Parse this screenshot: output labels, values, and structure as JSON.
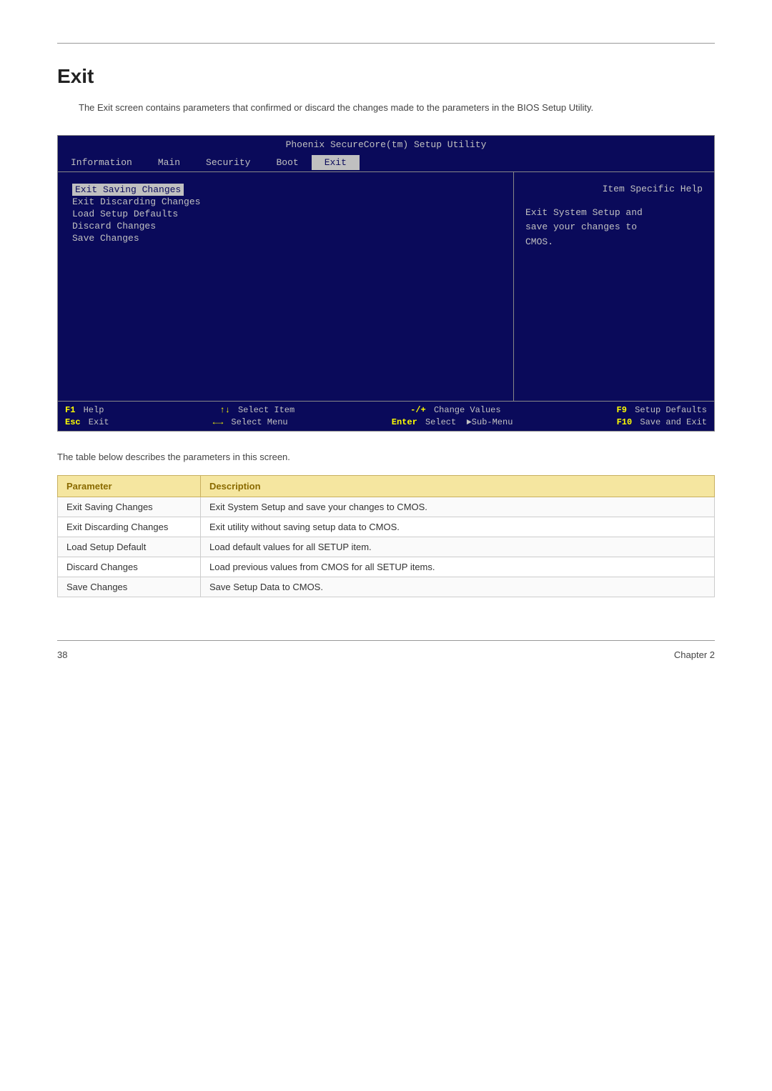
{
  "page": {
    "title": "Exit",
    "intro": "The Exit screen contains parameters that confirmed or discard the changes made to the parameters in the BIOS Setup Utility."
  },
  "bios": {
    "title": "Phoenix SecureCore(tm) Setup Utility",
    "nav": {
      "items": [
        {
          "label": "Information",
          "active": false
        },
        {
          "label": "Main",
          "active": false
        },
        {
          "label": "Security",
          "active": false
        },
        {
          "label": "Boot",
          "active": false
        },
        {
          "label": "Exit",
          "active": true
        }
      ]
    },
    "menu": {
      "items": [
        {
          "label": "Exit Saving Changes",
          "highlighted": true
        },
        {
          "label": "Exit Discarding Changes",
          "highlighted": false
        },
        {
          "label": "Load Setup Defaults",
          "highlighted": false
        },
        {
          "label": "Discard Changes",
          "highlighted": false
        },
        {
          "label": "Save Changes",
          "highlighted": false
        }
      ]
    },
    "help": {
      "title": "Item Specific Help",
      "text": "Exit System Setup and\nsave your changes to\nCMOS."
    },
    "footer": {
      "row1": [
        {
          "key": "F1",
          "desc": "Help"
        },
        {
          "key": "↑↓",
          "desc": "Select Item"
        },
        {
          "key": "-/+",
          "desc": "Change Values"
        },
        {
          "key": "F9",
          "desc": "Setup Defaults"
        }
      ],
      "row2": [
        {
          "key": "Esc",
          "desc": "Exit"
        },
        {
          "key": "←→",
          "desc": "Select Menu"
        },
        {
          "key": "Enter",
          "desc": "Select"
        },
        {
          "key": "►Sub-Menu"
        },
        {
          "key": "F10",
          "desc": "Save and Exit"
        }
      ]
    }
  },
  "desc_text": "The table below describes the parameters in this screen.",
  "table": {
    "headers": [
      "Parameter",
      "Description"
    ],
    "rows": [
      {
        "param": "Exit Saving Changes",
        "desc": "Exit System Setup and save your changes to CMOS."
      },
      {
        "param": "Exit Discarding Changes",
        "desc": "Exit utility without saving setup data to CMOS."
      },
      {
        "param": "Load Setup Default",
        "desc": "Load default values for all SETUP item."
      },
      {
        "param": "Discard Changes",
        "desc": "Load previous values from CMOS for all SETUP items."
      },
      {
        "param": "Save Changes",
        "desc": "Save Setup Data to CMOS."
      }
    ]
  },
  "footer": {
    "page_number": "38",
    "chapter": "Chapter 2"
  }
}
